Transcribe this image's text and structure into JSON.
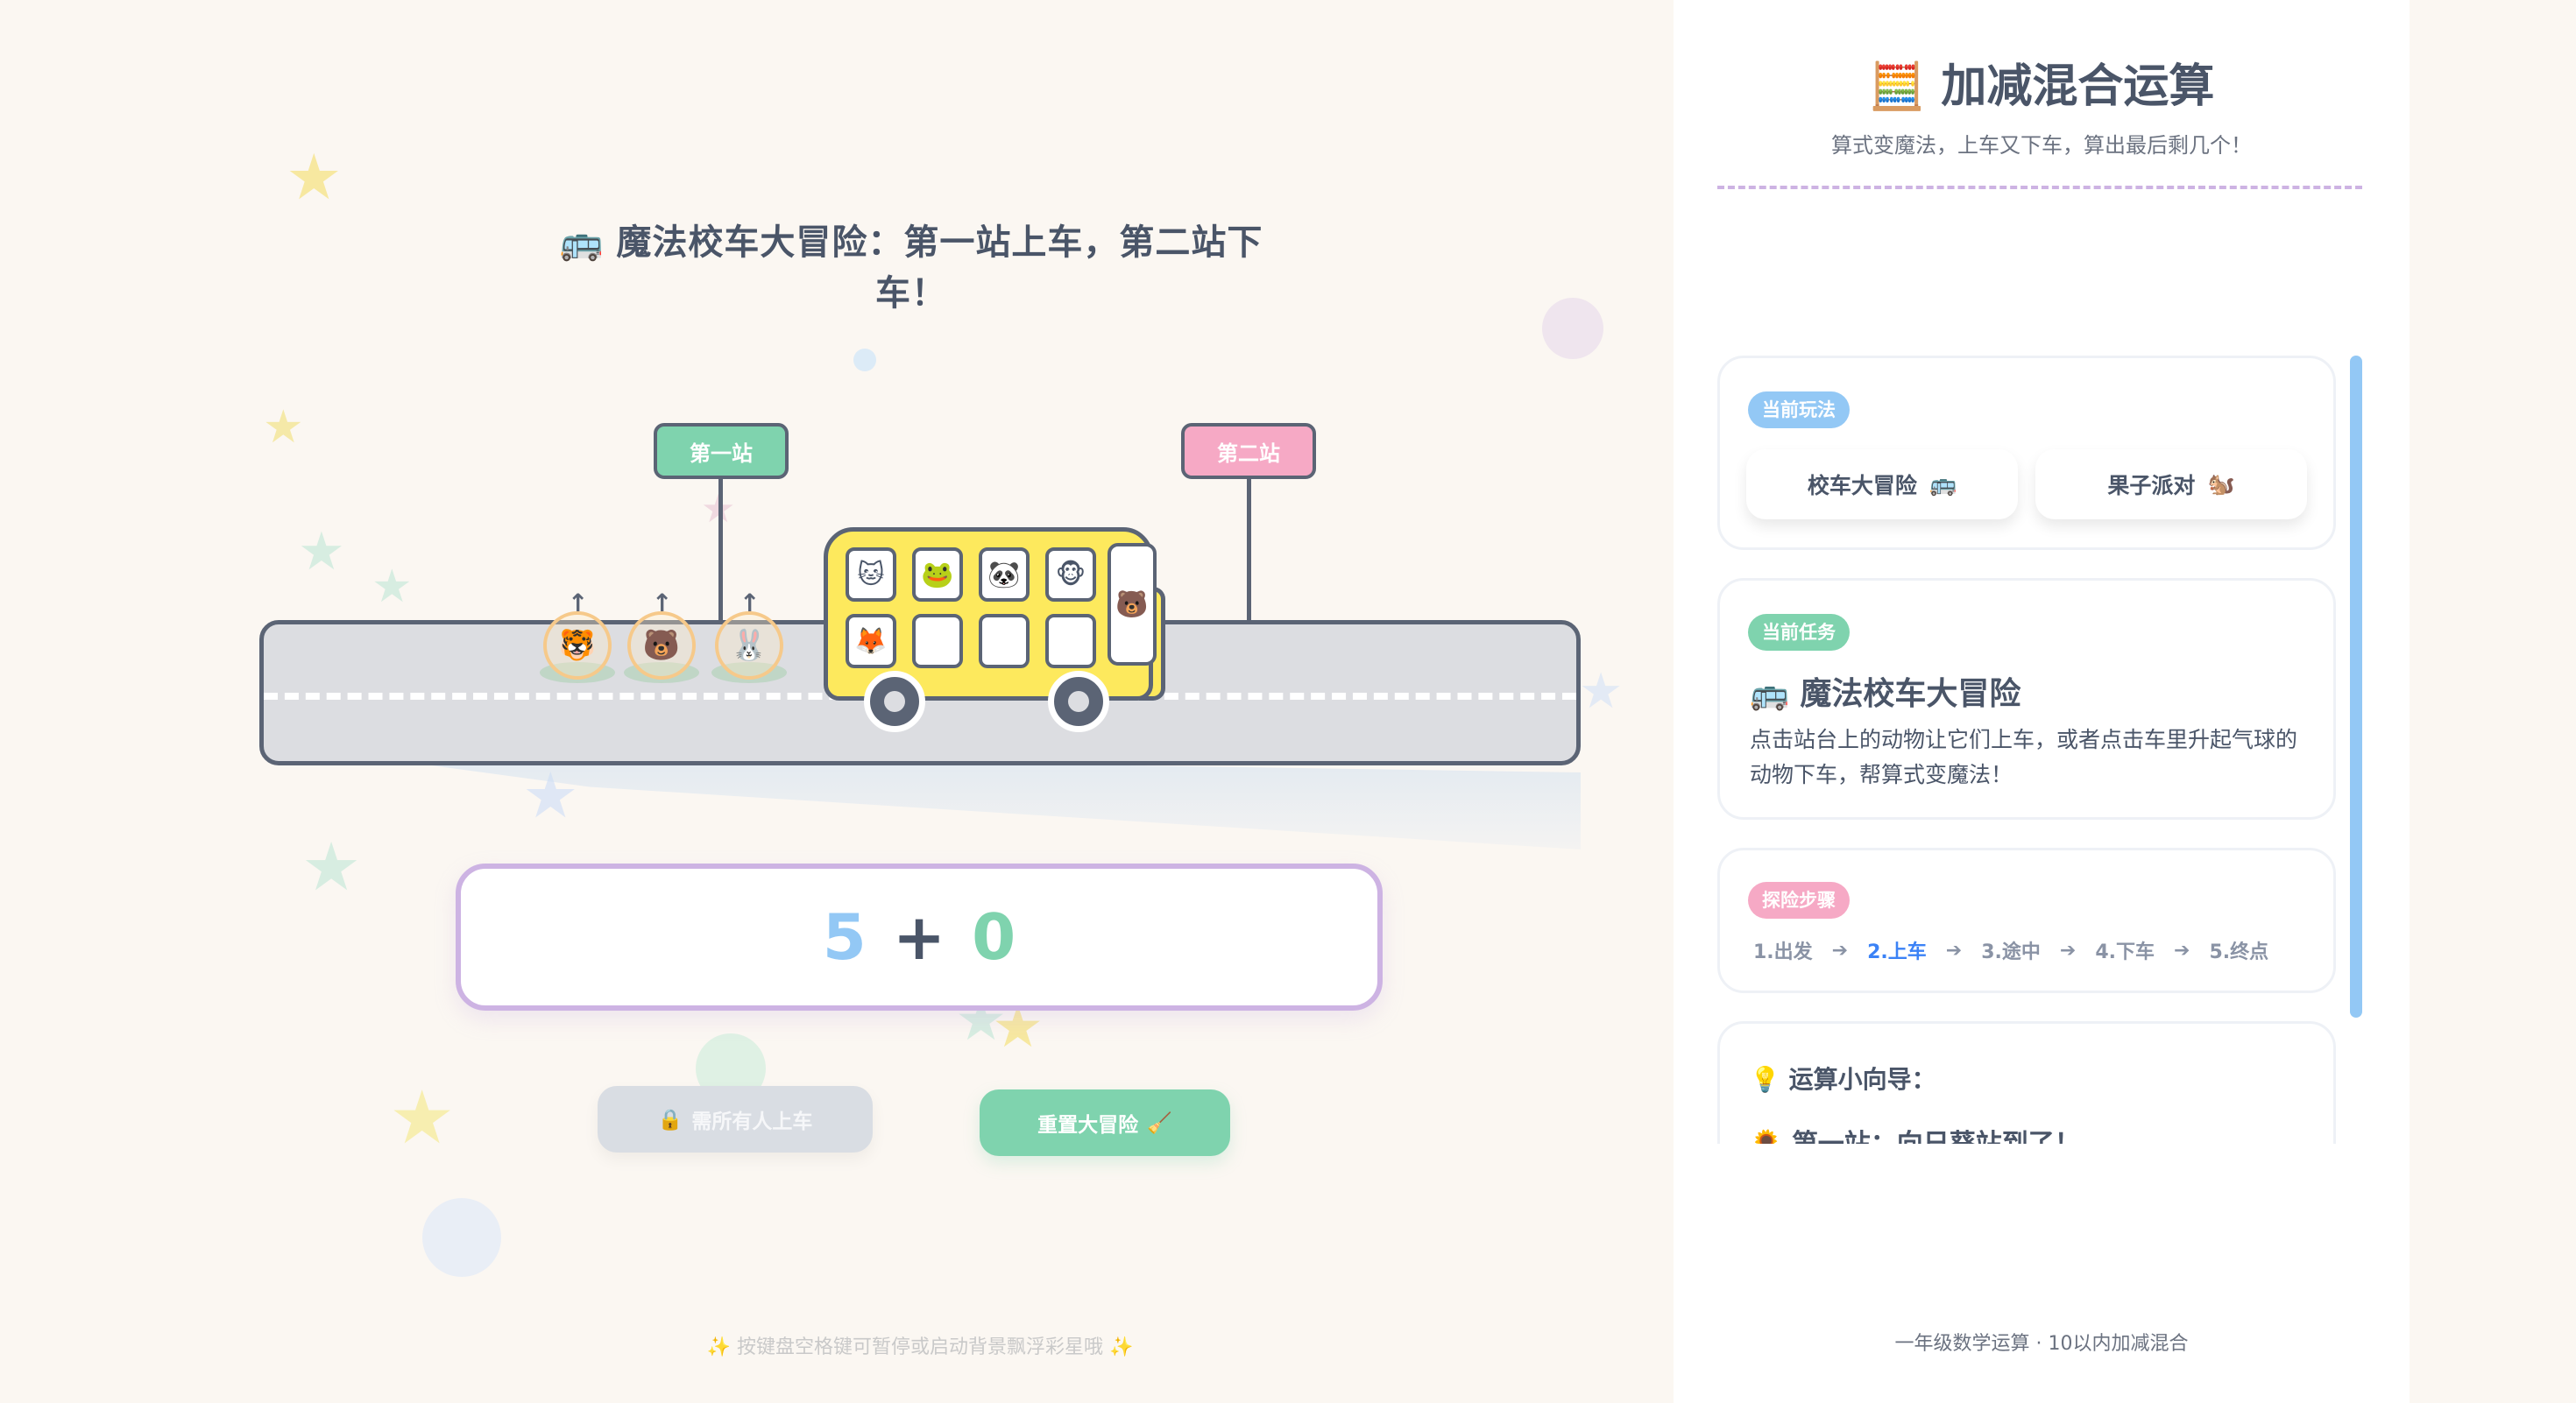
{
  "scene": {
    "title_icon": "🚌",
    "title": "魔法校车大冒险：第一站上车，第二站下车！",
    "station_1": "第一站",
    "station_2": "第二站",
    "waiting_animals": [
      "🐯",
      "🐻",
      "🐰"
    ],
    "up_arrow": "↑",
    "bus_seats_top": [
      "🐱",
      "🐸",
      "🐼",
      "🐵"
    ],
    "bus_seats_bottom": [
      "🦊",
      "",
      "",
      ""
    ],
    "bus_door_animal": "🐻"
  },
  "equation": {
    "a": "5",
    "op": "+",
    "b": "0"
  },
  "buttons": {
    "wait_icon": "🔒",
    "wait_label": "需所有人上车",
    "reset_label": "重置大冒险",
    "reset_icon": "🧹"
  },
  "footer_hint": "✨ 按键盘空格键可暂停或启动背景飘浮彩星哦 ✨",
  "sidebar": {
    "title_icon": "🧮",
    "title": "加减混合运算",
    "subtitle": "算式变魔法，上车又下车，算出最后剩几个！",
    "mode": {
      "tag": "当前玩法",
      "options": [
        {
          "label": "校车大冒险",
          "icon": "🚌"
        },
        {
          "label": "果子派对",
          "icon": "🐿️"
        }
      ]
    },
    "task": {
      "tag": "当前任务",
      "icon": "🚌",
      "title": "魔法校车大冒险",
      "description": "点击站台上的动物让它们上车，或者点击车里升起气球的动物下车，帮算式变魔法！"
    },
    "steps": {
      "tag": "探险步骤",
      "items": [
        "1.出发",
        "2.上车",
        "3.途中",
        "4.下车",
        "5.终点"
      ],
      "active_index": 1,
      "arrow": "➔"
    },
    "guide": {
      "icon": "💡",
      "title": "运算小向导：",
      "line_icon": "🌻",
      "line": "第一站：向日葵站到了！"
    },
    "footer": "一年级数学运算 · 10以内加减混合"
  },
  "colors": {
    "background": "#fbf7f2",
    "mint": "#7fd3ae",
    "pink": "#f6a9c5",
    "sky": "#93c8f5",
    "lavender": "#cdb3e3",
    "bus_yellow": "#fde95d",
    "outline": "#5b6475"
  }
}
